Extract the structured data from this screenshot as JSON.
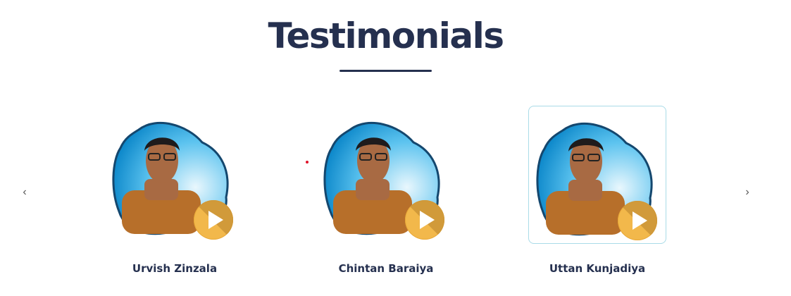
{
  "section": {
    "title": "Testimonials"
  },
  "carousel": {
    "prev_icon": "chevron-left-icon",
    "next_icon": "chevron-right-icon",
    "prev_glyph": "‹",
    "next_glyph": "›",
    "items": [
      {
        "name": "Urvish Zinzala",
        "icon": "play-icon"
      },
      {
        "name": "Chintan Baraiya",
        "icon": "play-icon"
      },
      {
        "name": "Uttan Kunjadiya",
        "icon": "play-icon"
      }
    ]
  },
  "colors": {
    "heading": "#25304f",
    "blob": "#1f8fd6",
    "play": "#f2b84b",
    "active_border": "#a9dbe8"
  }
}
